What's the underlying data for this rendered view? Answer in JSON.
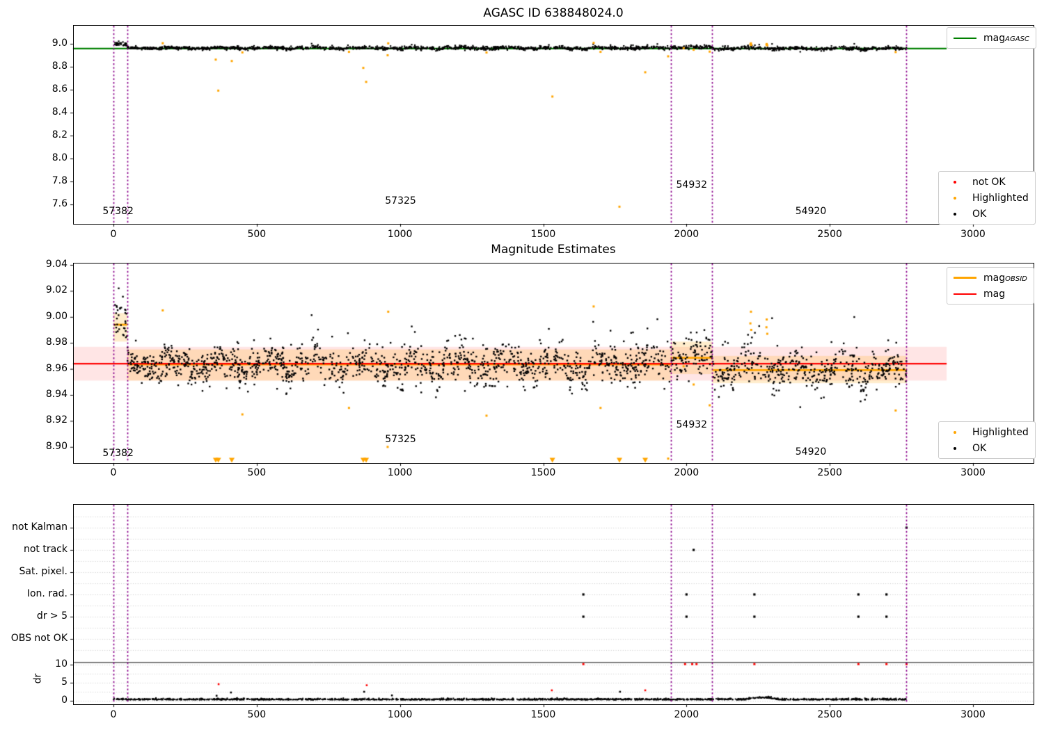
{
  "colors": {
    "ok": "#000000",
    "highlighted": "#ffa500",
    "not_ok": "#ff0000",
    "mag_agasc": "#008000",
    "mag": "#ff0000",
    "mag_obsid": "#ffa500",
    "vline": "#8B008B",
    "band_red": "rgba(255,0,0,0.10)",
    "band_orange": "rgba(255,165,0,0.20)",
    "grid": "#c8c8c8",
    "frame": "#000000"
  },
  "chart_data": [
    {
      "type": "scatter",
      "title": "AGASC ID 638848024.0",
      "xlim": [
        -141,
        3218
      ],
      "ylim": [
        7.43,
        9.165
      ],
      "xticks": [
        0,
        500,
        1000,
        1500,
        2000,
        2500,
        3000
      ],
      "yticks": [
        9.0,
        8.8,
        8.6,
        8.4,
        8.2,
        8.0,
        7.8,
        7.6
      ],
      "mag_agasc_line": {
        "label_main": "mag",
        "label_sub": "AGASC",
        "value": 8.958,
        "x_start": -141,
        "x_end": 2908
      },
      "vlines": [
        0,
        48,
        1945,
        2090,
        2768
      ],
      "annotations": [
        {
          "text": "57382",
          "x": -38,
          "y": 7.52
        },
        {
          "text": "57325",
          "x": 948,
          "y": 7.61
        },
        {
          "text": "54932",
          "x": 1964,
          "y": 7.75
        },
        {
          "text": "54920",
          "x": 2380,
          "y": 7.52
        }
      ],
      "legend_line": {
        "items": [
          {
            "label_main": "mag",
            "label_sub": "AGASC"
          }
        ]
      },
      "legend_markers": {
        "items": [
          {
            "label": "not OK"
          },
          {
            "label": "Highlighted"
          },
          {
            "label": "OK"
          }
        ]
      }
    },
    {
      "type": "scatter",
      "title": "Magnitude Estimates",
      "xlim": [
        -141,
        3218
      ],
      "ylim": [
        8.888,
        9.0415
      ],
      "xticks": [
        0,
        500,
        1000,
        1500,
        2000,
        2500,
        3000
      ],
      "yticks": [
        9.04,
        9.02,
        9.0,
        8.98,
        8.96,
        8.94,
        8.92,
        8.9
      ],
      "mag_line": {
        "label_main": "mag",
        "label_sub": "",
        "value": 8.964,
        "x_start": -141,
        "x_end": 2908
      },
      "mag_band": [
        8.951,
        8.977
      ],
      "obsid_segments": [
        {
          "x_start": 0,
          "x_end": 48,
          "mag": 8.994,
          "band": [
            8.981,
            9.003
          ]
        },
        {
          "x_start": 48,
          "x_end": 1945,
          "mag": 8.9635,
          "band": [
            8.951,
            8.975
          ]
        },
        {
          "x_start": 1945,
          "x_end": 2090,
          "mag": 8.9685,
          "band": [
            8.956,
            8.981
          ]
        },
        {
          "x_start": 2090,
          "x_end": 2768,
          "mag": 8.959,
          "band": [
            8.949,
            8.97
          ]
        }
      ],
      "vlines": [
        0,
        48,
        1945,
        2090,
        2768
      ],
      "annotations": [
        {
          "text": "57382",
          "x": -38,
          "y": 8.8935
        },
        {
          "text": "57325",
          "x": 948,
          "y": 8.904
        },
        {
          "text": "54932",
          "x": 1964,
          "y": 8.9155
        },
        {
          "text": "54920",
          "x": 2380,
          "y": 8.8945
        }
      ],
      "legend_lines": {
        "items": [
          {
            "label_main": "mag",
            "label_sub": "OBSID"
          },
          {
            "label_main": "mag",
            "label_sub": ""
          }
        ]
      },
      "legend_markers": {
        "items": [
          {
            "label": "Highlighted"
          },
          {
            "label": "OK"
          }
        ]
      },
      "highlighted": [
        [
          172,
          9.005
        ],
        [
          357,
          8.862
        ],
        [
          366,
          8.592
        ],
        [
          413,
          8.85
        ],
        [
          450,
          8.925
        ],
        [
          822,
          8.93
        ],
        [
          872,
          8.79
        ],
        [
          882,
          8.668
        ],
        [
          957,
          8.9
        ],
        [
          959,
          9.004
        ],
        [
          1302,
          8.924
        ],
        [
          1532,
          8.54
        ],
        [
          1676,
          9.008
        ],
        [
          1700,
          8.93
        ],
        [
          1766,
          7.58
        ],
        [
          1856,
          8.752
        ],
        [
          1936,
          8.891
        ],
        [
          1990,
          8.962
        ],
        [
          2025,
          8.948
        ],
        [
          2081,
          8.932
        ],
        [
          2223,
          8.995
        ],
        [
          2225,
          9.004
        ],
        [
          2226,
          8.99
        ],
        [
          2279,
          8.992
        ],
        [
          2280,
          8.998
        ],
        [
          2282,
          8.987
        ],
        [
          2730,
          8.928
        ]
      ],
      "ok_cloud": {
        "n": 1900,
        "x_range": [
          48,
          2768
        ],
        "noise": 0.0066,
        "wave_amp_1": 0.0048,
        "wave_amp_2": 0.0042,
        "spike_up_frac": 0.045,
        "spike_down_frac": 0.04,
        "initial": {
          "n": 32,
          "x_range": [
            0,
            48
          ],
          "center": 8.998,
          "noise": 0.0082,
          "floor": 8.982
        }
      }
    },
    {
      "type": "scatter",
      "title": "",
      "categories": [
        "not Kalman",
        "not track",
        "Sat. pixel.",
        "Ion. rad.",
        "dr > 5",
        "OBS not OK"
      ],
      "ylabel": "dr",
      "dr_ticks": [
        10,
        5,
        0
      ],
      "xticks": [
        0,
        500,
        1000,
        1500,
        2000,
        2500,
        3000
      ],
      "vlines": [
        0,
        48,
        1945,
        2090,
        2768
      ],
      "separator_dr": 10.6,
      "flag_points": [
        {
          "category": "not Kalman",
          "x": [
            2768
          ]
        },
        {
          "category": "not track",
          "x": [
            2025
          ]
        },
        {
          "category": "Sat. pixel.",
          "x": []
        },
        {
          "category": "Ion. rad.",
          "x": [
            1640,
            2000,
            2237,
            2600,
            2698
          ]
        },
        {
          "category": "dr > 5",
          "x": [
            1640,
            2000,
            2237,
            2600,
            2698
          ]
        },
        {
          "category": "OBS not OK",
          "x": []
        }
      ],
      "red_points_dr10": [
        1640,
        1995,
        2020,
        2035,
        2237,
        2600,
        2698,
        2768
      ],
      "red_points_dr": [
        [
          367,
          4.6
        ],
        [
          884,
          4.3
        ],
        [
          1530,
          2.9
        ],
        [
          1856,
          2.9
        ]
      ],
      "black_outliers_dr": [
        [
          360,
          1.4
        ],
        [
          410,
          2.3
        ],
        [
          875,
          2.5
        ],
        [
          972,
          1.5
        ],
        [
          1768,
          2.5
        ]
      ],
      "dr_cloud": {
        "n": 1900,
        "x_range": [
          0,
          2768
        ],
        "base": 0.28,
        "noise": 0.16,
        "bump": {
          "x_range": [
            2210,
            2320
          ],
          "height": 0.45
        }
      }
    }
  ]
}
